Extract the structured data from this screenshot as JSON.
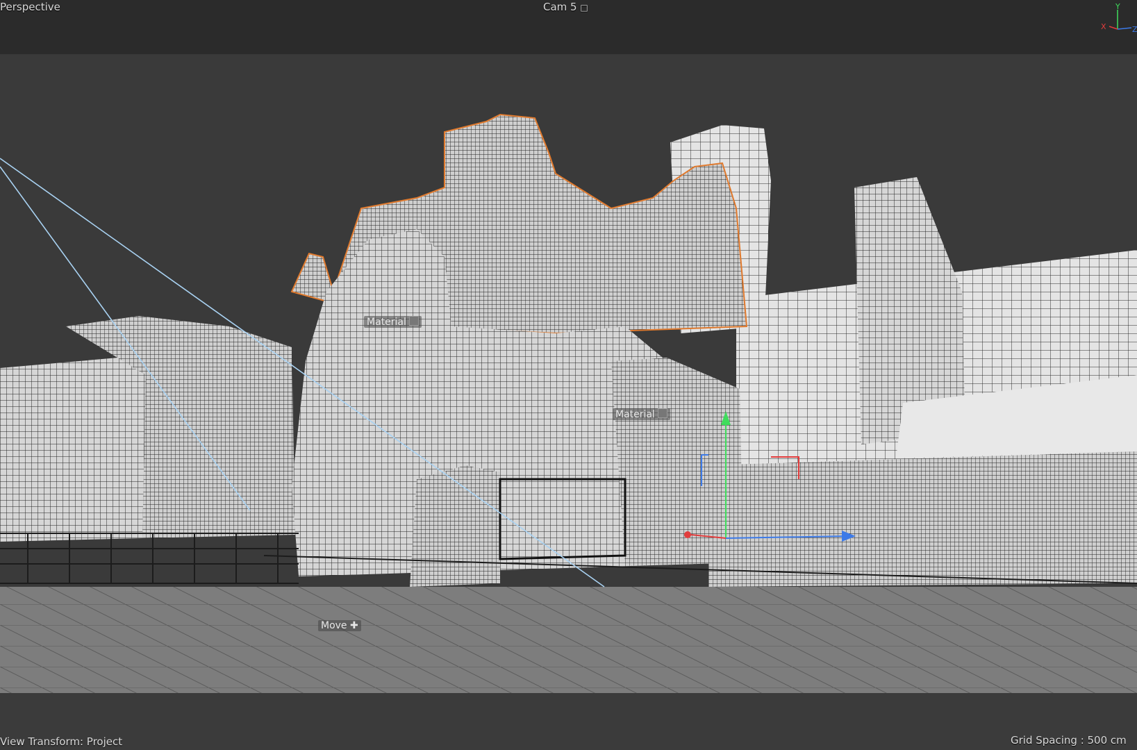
{
  "viewport": {
    "name": "Perspective",
    "camera": "Cam 5",
    "view_transform": "View Transform: Project",
    "grid_spacing": "Grid Spacing : 500 cm"
  },
  "axis_gizmo": {
    "x": "X",
    "y": "Y",
    "z": "Z"
  },
  "tags": [
    {
      "label": "Material"
    },
    {
      "label": "Material"
    }
  ],
  "tool": {
    "label": "Move"
  },
  "colors": {
    "background": "#3a3a3a",
    "mesh_fill": "#d8d8d8",
    "wire": "#1e1e1e",
    "selection_outline": "#e07a2e",
    "camera_line": "#a9d2f2",
    "axis_x": "#e23c3c",
    "axis_y": "#3fdc5c",
    "axis_z": "#3c7ae8"
  }
}
